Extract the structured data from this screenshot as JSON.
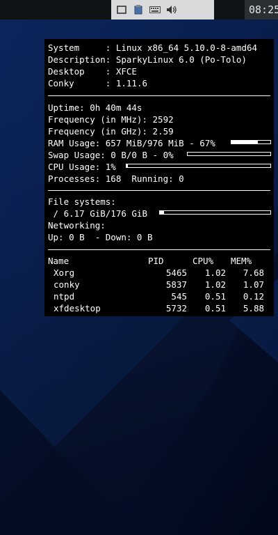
{
  "panel": {
    "clock": "08:25",
    "tray_icons": [
      "window-icon",
      "clipboard-icon",
      "keyboard-icon",
      "volume-icon"
    ]
  },
  "conky": {
    "system": {
      "system_key": "System     : ",
      "system_val": "Linux x86_64 5.10.0-8-amd64",
      "desc_key": "Description: ",
      "desc_val": "SparkyLinux 6.0 (Po-Tolo)",
      "desktop_key": "Desktop    : ",
      "desktop_val": "XFCE",
      "conky_key": "Conky      : ",
      "conky_val": "1.11.6"
    },
    "stats": {
      "uptime": "Uptime: 0h 40m 44s",
      "freq_mhz": "Frequency (in MHz): 2592",
      "freq_ghz": "Frequency (in GHz): 2.59",
      "ram": "RAM Usage: 657 MiB/976 MiB - 67%",
      "ram_pct": 67,
      "swap": "Swap Usage: 0 B/0 B - 0%",
      "swap_pct": 0,
      "cpu": "CPU Usage: 1%",
      "cpu_pct": 1,
      "processes": "Processes: 168  Running: 0"
    },
    "fs": {
      "header": "File systems:",
      "root": " / 6.17 GiB/176 GiB",
      "root_pct": 4,
      "net_header": "Networking:",
      "net": "Up: 0 B  - Down: 0 B"
    },
    "procs": {
      "headers": [
        "Name",
        "PID",
        "CPU%",
        "MEM%"
      ],
      "rows": [
        [
          "Xorg",
          "5465",
          "1.02",
          "7.68"
        ],
        [
          "conky",
          "5837",
          "1.02",
          "1.07"
        ],
        [
          "ntpd",
          "545",
          "0.51",
          "0.12"
        ],
        [
          "xfdesktop",
          "5732",
          "0.51",
          "5.88"
        ]
      ]
    }
  }
}
